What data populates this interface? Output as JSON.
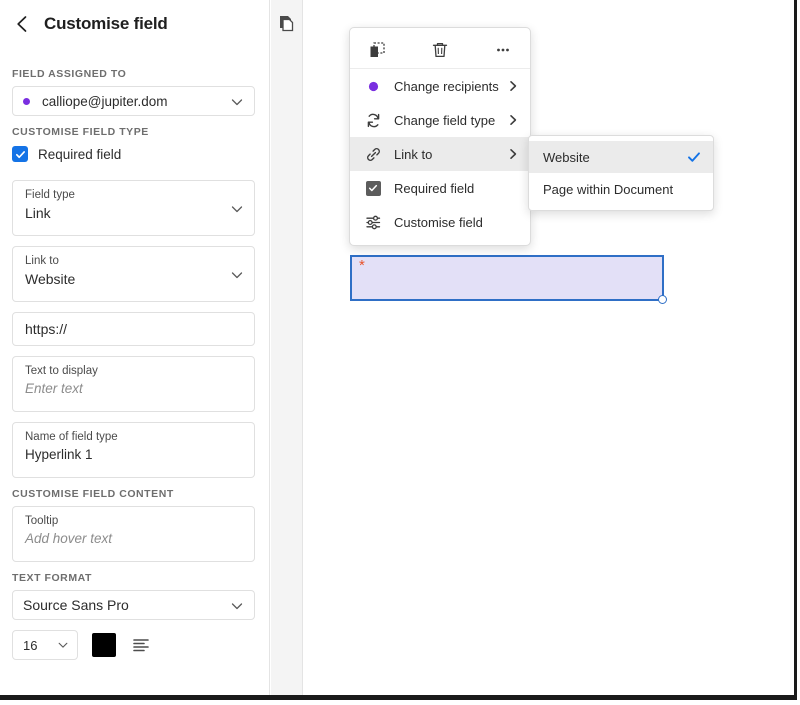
{
  "sidebar": {
    "back_icon": "chevron-left-icon",
    "title": "Customise field",
    "sections": {
      "assigned": "FIELD ASSIGNED TO",
      "field_type": "CUSTOMISE FIELD TYPE",
      "field_content": "CUSTOMISE FIELD CONTENT",
      "text_format": "TEXT FORMAT"
    },
    "recipient": {
      "value": "calliope@jupiter.dom",
      "dot_color": "#7a2fe0",
      "chevron_icon": "chevron-down-icon"
    },
    "required_field": {
      "label": "Required field",
      "checked": true,
      "accent": "#1473e6"
    },
    "fields": [
      {
        "label": "Field type",
        "value": "Link",
        "chevron": true
      },
      {
        "label": "Link to",
        "value": "Website",
        "chevron": true
      }
    ],
    "url_field": {
      "value": "https://"
    },
    "text_to_display": {
      "label": "Text to display",
      "placeholder": "Enter text"
    },
    "name_of_field": {
      "label": "Name of field type",
      "value": "Hyperlink 1"
    },
    "tooltip_field": {
      "label": "Tooltip",
      "placeholder": "Add hover text"
    },
    "font_family": {
      "value": "Source Sans Pro",
      "chevron_icon": "chevron-down-icon"
    },
    "font_size": {
      "value": "16",
      "chevron_icon": "chevron-down-icon"
    },
    "font_color": {
      "swatch": "#000000",
      "name": "color-swatch"
    },
    "alignment": {
      "icon": "text-align-left-icon"
    }
  },
  "rail": {
    "pages_icon": "pages-thumbnail-icon"
  },
  "context_menu": {
    "toolbar": [
      {
        "icon": "duplicate-field-icon",
        "name": "duplicate-button"
      },
      {
        "icon": "trash-icon",
        "name": "delete-button"
      },
      {
        "icon": "more-options-icon",
        "name": "more-options-button"
      }
    ],
    "items": [
      {
        "label": "Change recipients",
        "icon": "recipient-dot-icon",
        "arrow": true,
        "highlighted": false
      },
      {
        "label": "Change field type",
        "icon": "swap-arrows-icon",
        "arrow": true,
        "highlighted": false
      },
      {
        "label": "Link to",
        "icon": "link-chain-icon",
        "arrow": true,
        "highlighted": true
      },
      {
        "label": "Required field",
        "icon": "checkbox-checked-icon",
        "arrow": false,
        "highlighted": false
      },
      {
        "label": "Customise field",
        "icon": "sliders-icon",
        "arrow": false,
        "highlighted": false
      }
    ]
  },
  "submenu": {
    "items": [
      {
        "label": "Website",
        "selected": true,
        "highlighted": true
      },
      {
        "label": "Page within Document",
        "selected": false,
        "highlighted": false
      }
    ],
    "check_color": "#1473e6"
  },
  "canvas": {
    "form_field": {
      "required_marker": "*",
      "fill": "#e3e0f7",
      "border": "#2f6fc6",
      "handle_name": "resize-handle"
    }
  }
}
